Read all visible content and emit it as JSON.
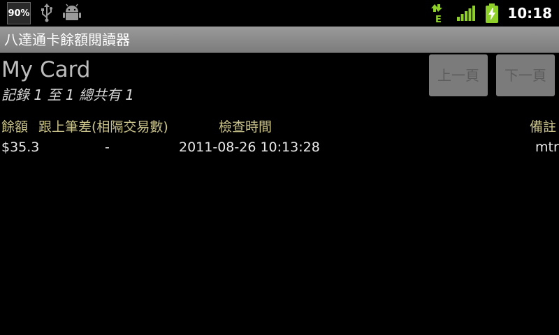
{
  "status_bar": {
    "battery_percent": "90%",
    "network_type": "E",
    "time": "10:18",
    "icons": [
      "usb-icon",
      "android-debug-icon",
      "data-transfer-icon",
      "signal-strength-icon",
      "battery-charging-icon"
    ]
  },
  "app": {
    "title": "八達通卡餘額閱讀器"
  },
  "card": {
    "name": "My Card",
    "summary": "記錄 1 至 1 總共有 1"
  },
  "buttons": {
    "prev": "上一頁",
    "next": "下一頁"
  },
  "table": {
    "headers": [
      "餘額",
      "跟上筆差(相隔交易數)",
      "檢查時間",
      "備註"
    ],
    "rows": [
      [
        "$35.3",
        "-",
        "2011-08-26 10:13:28",
        "mtr"
      ]
    ]
  },
  "colors": {
    "background": "#000000",
    "title_bar": "#8a8a8a",
    "header_text": "#cbc48a",
    "icon_green": "#8fd12a"
  }
}
